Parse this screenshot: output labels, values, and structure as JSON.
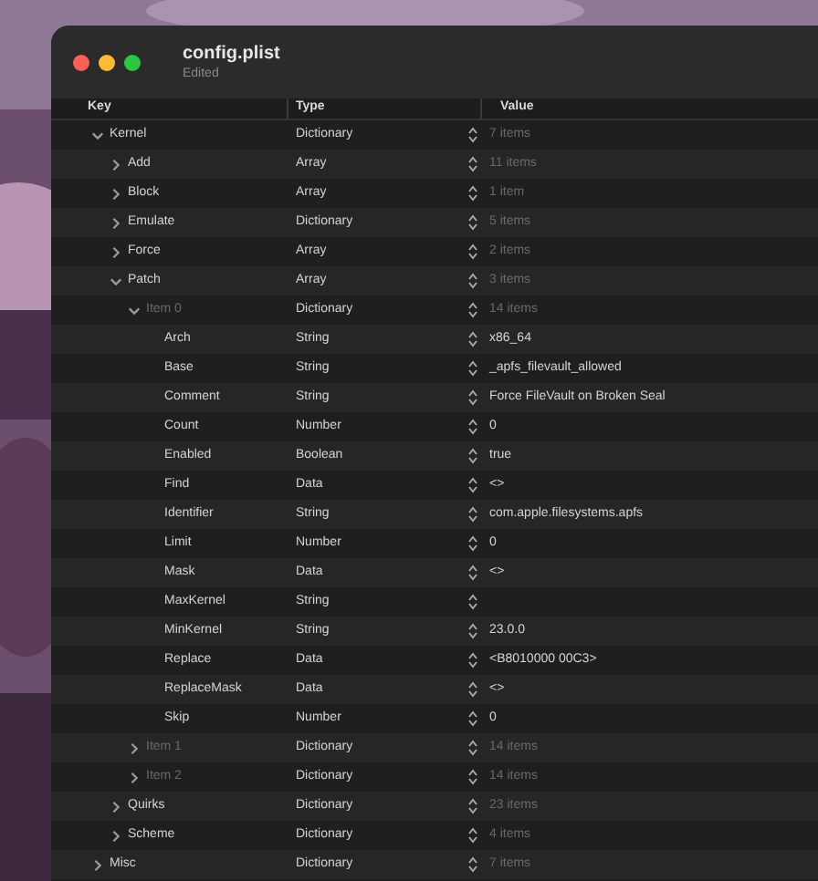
{
  "window": {
    "title": "config.plist",
    "subtitle": "Edited"
  },
  "columns": [
    "Key",
    "Type",
    "Value"
  ],
  "tree": [
    {
      "key": "Kernel",
      "type": "Dictionary",
      "value": "7 items",
      "kind": "key",
      "expanded": true,
      "children": [
        {
          "key": "Add",
          "type": "Array",
          "value": "11 items",
          "kind": "key",
          "expanded": false
        },
        {
          "key": "Block",
          "type": "Array",
          "value": "1 item",
          "kind": "key",
          "expanded": false
        },
        {
          "key": "Emulate",
          "type": "Dictionary",
          "value": "5 items",
          "kind": "key",
          "expanded": false
        },
        {
          "key": "Force",
          "type": "Array",
          "value": "2 items",
          "kind": "key",
          "expanded": false
        },
        {
          "key": "Patch",
          "type": "Array",
          "value": "3 items",
          "kind": "key",
          "expanded": true,
          "children": [
            {
              "key": "Item 0",
              "type": "Dictionary",
              "value": "14 items",
              "kind": "index",
              "expanded": true,
              "children": [
                {
                  "key": "Arch",
                  "type": "String",
                  "value": "x86_64",
                  "kind": "key"
                },
                {
                  "key": "Base",
                  "type": "String",
                  "value": "_apfs_filevault_allowed",
                  "kind": "key"
                },
                {
                  "key": "Comment",
                  "type": "String",
                  "value": "Force FileVault on Broken Seal",
                  "kind": "key"
                },
                {
                  "key": "Count",
                  "type": "Number",
                  "value": "0",
                  "kind": "key"
                },
                {
                  "key": "Enabled",
                  "type": "Boolean",
                  "value": "true",
                  "kind": "key"
                },
                {
                  "key": "Find",
                  "type": "Data",
                  "value": "<>",
                  "kind": "key"
                },
                {
                  "key": "Identifier",
                  "type": "String",
                  "value": "com.apple.filesystems.apfs",
                  "kind": "key"
                },
                {
                  "key": "Limit",
                  "type": "Number",
                  "value": "0",
                  "kind": "key"
                },
                {
                  "key": "Mask",
                  "type": "Data",
                  "value": "<>",
                  "kind": "key"
                },
                {
                  "key": "MaxKernel",
                  "type": "String",
                  "kind": "key"
                },
                {
                  "key": "MinKernel",
                  "type": "String",
                  "value": "23.0.0",
                  "kind": "key"
                },
                {
                  "key": "Replace",
                  "type": "Data",
                  "value": "<B8010000 00C3>",
                  "kind": "key"
                },
                {
                  "key": "ReplaceMask",
                  "type": "Data",
                  "value": "<>",
                  "kind": "key"
                },
                {
                  "key": "Skip",
                  "type": "Number",
                  "value": "0",
                  "kind": "key"
                }
              ]
            },
            {
              "key": "Item 1",
              "type": "Dictionary",
              "value": "14 items",
              "kind": "index",
              "expanded": false
            },
            {
              "key": "Item 2",
              "type": "Dictionary",
              "value": "14 items",
              "kind": "index",
              "expanded": false
            }
          ]
        },
        {
          "key": "Quirks",
          "type": "Dictionary",
          "value": "23 items",
          "kind": "key",
          "expanded": false
        },
        {
          "key": "Scheme",
          "type": "Dictionary",
          "value": "4 items",
          "kind": "key",
          "expanded": false
        }
      ]
    },
    {
      "key": "Misc",
      "type": "Dictionary",
      "value": "7 items",
      "kind": "key",
      "expanded": false
    }
  ]
}
